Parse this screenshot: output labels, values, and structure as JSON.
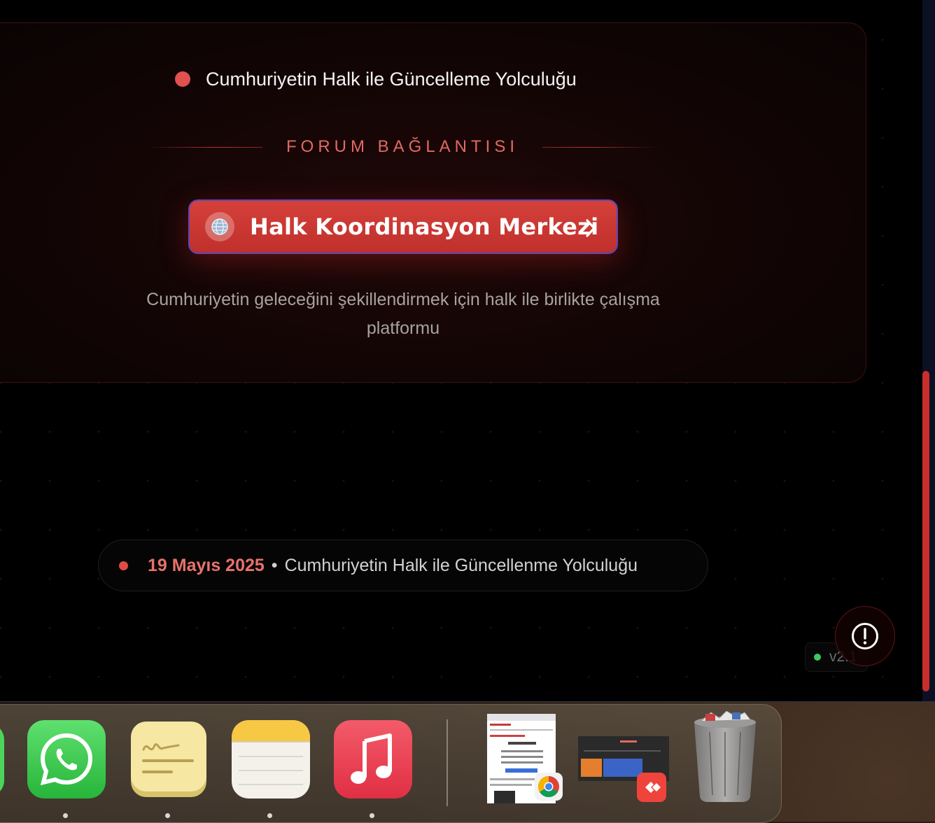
{
  "card": {
    "title": "Cumhuriyetin Halk ile Güncelleme Yolculuğu",
    "section_label": "FORUM BAĞLANTISI",
    "cta_label": "Halk Koordinasyon Merkezi",
    "cta_icon": "globe-icon",
    "description_line1": "Cumhuriyetin geleceğini şekillendirmek için halk ile birlikte çalışma",
    "description_line2": "platformu"
  },
  "footer": {
    "date": "19 Mayıs 2025",
    "separator": "•",
    "subtitle": "Cumhuriyetin Halk ile Güncellenme Yolculuğu"
  },
  "version": {
    "label": "v2.1",
    "status_color": "#3ec95c"
  },
  "alert_button": {
    "icon": "alert-circle-icon"
  },
  "colors": {
    "accent": "#d5403a",
    "accent_text": "#e06a62",
    "background": "#000000"
  },
  "dock": {
    "apps": [
      {
        "name": "WhatsApp",
        "icon": "whatsapp-icon",
        "running": true
      },
      {
        "name": "Stickies",
        "icon": "stickies-icon",
        "running": true
      },
      {
        "name": "Notes",
        "icon": "notes-icon",
        "running": true
      },
      {
        "name": "Music",
        "icon": "music-icon",
        "running": true
      }
    ],
    "minimized": [
      {
        "name": "Chrome window",
        "icon": "chrome-icon"
      },
      {
        "name": "AnyDesk window",
        "icon": "anydesk-icon"
      }
    ],
    "trash": {
      "name": "Trash",
      "icon": "trash-icon"
    }
  }
}
